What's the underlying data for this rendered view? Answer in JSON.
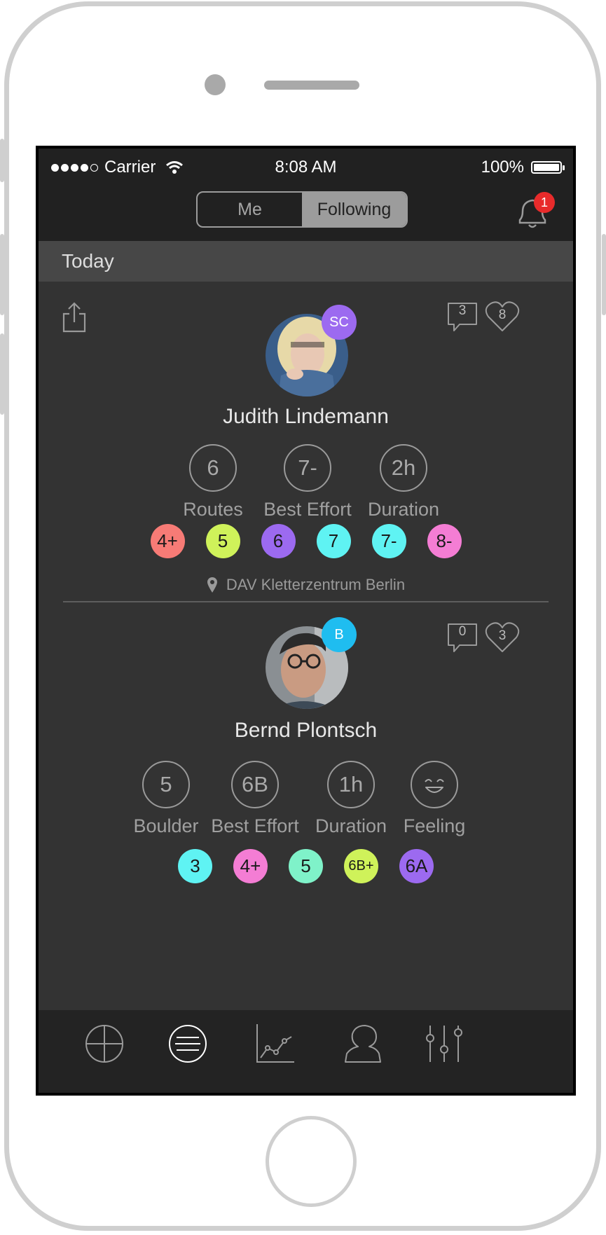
{
  "status": {
    "carrier": "Carrier",
    "time": "8:08 AM",
    "battery": "100%"
  },
  "segment": {
    "options": [
      "Me",
      "Following"
    ],
    "selected": "Following"
  },
  "notifications": {
    "count": "1"
  },
  "section_title": "Today",
  "feed": [
    {
      "initials": "SC",
      "initials_color": "#9c6af0",
      "name": "Judith Lindemann",
      "comments": "3",
      "likes": "8",
      "stats": [
        {
          "value": "6",
          "label": "Routes"
        },
        {
          "value": "7-",
          "label": "Best Effort"
        },
        {
          "value": "2h",
          "label": "Duration"
        }
      ],
      "grades": [
        {
          "label": "4+",
          "color": "#f77b76"
        },
        {
          "label": "5",
          "color": "#cff25a"
        },
        {
          "label": "6",
          "color": "#9c6af0"
        },
        {
          "label": "7",
          "color": "#5ff3f3"
        },
        {
          "label": "7-",
          "color": "#5ff3f3"
        },
        {
          "label": "8-",
          "color": "#f47dd4"
        }
      ],
      "location": "DAV Kletterzentrum Berlin"
    },
    {
      "initials": "B",
      "initials_color": "#1fbdf0",
      "name": "Bernd Plontsch",
      "comments": "0",
      "likes": "3",
      "stats": [
        {
          "value": "5",
          "label": "Boulder"
        },
        {
          "value": "6B",
          "label": "Best Effort"
        },
        {
          "value": "1h",
          "label": "Duration"
        },
        {
          "value": "",
          "label": "Feeling",
          "icon": "smile-icon"
        }
      ],
      "grades": [
        {
          "label": "3",
          "color": "#5ff3f3"
        },
        {
          "label": "4+",
          "color": "#f47dd4"
        },
        {
          "label": "5",
          "color": "#7ff2c9"
        },
        {
          "label": "6B+",
          "color": "#cff25a"
        },
        {
          "label": "6A",
          "color": "#9c6af0"
        }
      ]
    }
  ],
  "tabbar": [
    "add-icon",
    "feed-icon",
    "chart-icon",
    "profile-icon",
    "settings-sliders-icon"
  ]
}
